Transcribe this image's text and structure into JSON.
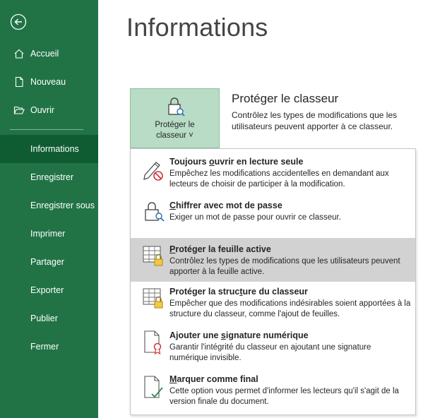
{
  "sidebar": {
    "back_icon": "back-arrow-icon",
    "top_items": [
      {
        "label": "Accueil",
        "icon": "home-icon"
      },
      {
        "label": "Nouveau",
        "icon": "new-document-icon"
      },
      {
        "label": "Ouvrir",
        "icon": "folder-open-icon"
      }
    ],
    "items": [
      {
        "label": "Informations",
        "active": true
      },
      {
        "label": "Enregistrer"
      },
      {
        "label": "Enregistrer sous"
      },
      {
        "label": "Imprimer"
      },
      {
        "label": "Partager"
      },
      {
        "label": "Exporter"
      },
      {
        "label": "Publier"
      },
      {
        "label": "Fermer"
      }
    ]
  },
  "main": {
    "title": "Informations",
    "protect_button": {
      "line1": "Protéger le",
      "line2": "classeur ˅",
      "icon": "lock-workbook-icon"
    },
    "section_title": "Protéger le classeur",
    "section_desc": "Contrôlez les types de modifications que les utilisateurs peuvent apporter à ce classeur."
  },
  "menu": {
    "items": [
      {
        "title_pre": "Toujours ",
        "title_u": "o",
        "title_post": "uvrir en lecture seule",
        "desc": "Empêchez les modifications accidentelles en demandant aux lecteurs de choisir de participer à la modification.",
        "icon": "pencil-no-icon"
      },
      {
        "title_pre": "",
        "title_u": "C",
        "title_post": "hiffrer avec mot de passe",
        "desc": "Exiger un mot de passe pour ouvrir ce classeur.",
        "icon": "lock-key-icon"
      },
      {
        "title_pre": "",
        "title_u": "P",
        "title_post": "rotéger la feuille active",
        "desc": "Contrôlez les types de modifications que les utilisateurs peuvent apporter à la feuille active.",
        "icon": "protect-sheet-icon",
        "highlight": true
      },
      {
        "title_pre": "Protéger la struc",
        "title_u": "t",
        "title_post": "ure du classeur",
        "desc": "Empêcher que des modifications indésirables soient apportées à la structure du classeur, comme l'ajout de feuilles.",
        "icon": "protect-structure-icon"
      },
      {
        "title_pre": "Ajouter une ",
        "title_u": "s",
        "title_post": "ignature numérique",
        "desc": "Garantir l'intégrité du classeur en ajoutant une signature numérique invisible.",
        "icon": "digital-signature-icon"
      },
      {
        "title_pre": "",
        "title_u": "M",
        "title_post": "arquer comme final",
        "desc": "Cette option vous permet d'informer les lecteurs qu'il s'agit de la version finale du document.",
        "icon": "mark-final-icon"
      }
    ]
  }
}
